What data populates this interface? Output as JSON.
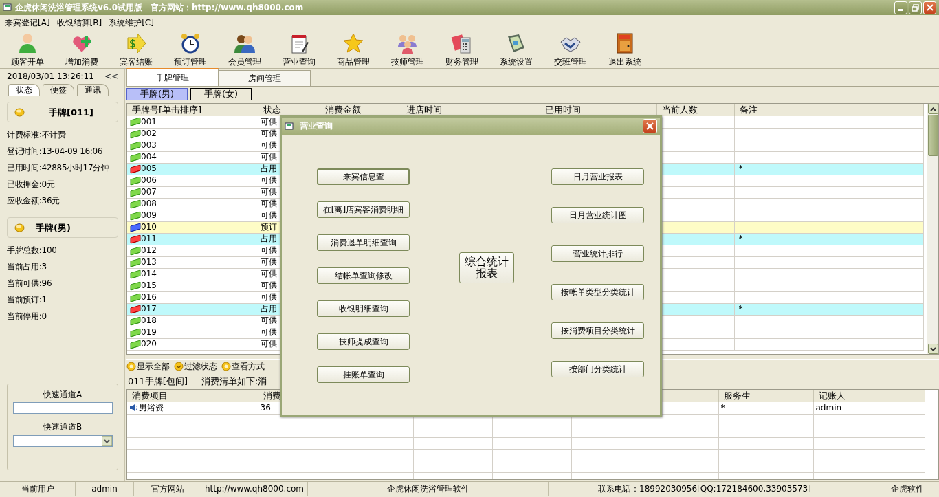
{
  "window": {
    "title": "企虎休闲洗浴管理系统v6.0试用版　官方网站：http://www.qh8000.com"
  },
  "menu": [
    "来宾登记[A]",
    "收银结算[B]",
    "系统维护[C]"
  ],
  "toolbar": [
    "顾客开单",
    "增加消费",
    "宾客结账",
    "预订管理",
    "会员管理",
    "营业查询",
    "商品管理",
    "技师管理",
    "财务管理",
    "系统设置",
    "交班管理",
    "退出系统"
  ],
  "left_panel": {
    "clock": "2018/03/01 13:26:11",
    "collapse": "<<",
    "tabs": [
      {
        "label": "状态",
        "selected": true
      },
      {
        "label": "便签",
        "selected": false
      },
      {
        "label": "通讯",
        "selected": false
      }
    ],
    "current_card": {
      "title": "手牌[011]",
      "lines": [
        "计费标准:不计费",
        "登记时间:13-04-09 16:06",
        "已用时间:42885小时17分钟",
        "已收押金:0元",
        "应收金额:36元"
      ]
    },
    "group": {
      "title": "手牌(男)",
      "lines": [
        "手牌总数:100",
        "当前占用:3",
        "当前可供:96",
        "当前预订:1",
        "当前停用:0"
      ]
    },
    "quick_a": {
      "label": "快速通道A"
    },
    "quick_b": {
      "label": "快速通道B"
    }
  },
  "tabs": [
    {
      "label": "手牌管理",
      "selected": true
    },
    {
      "label": "房间管理",
      "selected": false
    }
  ],
  "subtabs": [
    {
      "label": "手牌(男)",
      "selected": true
    },
    {
      "label": "手牌(女)",
      "selected": false
    }
  ],
  "card_table": {
    "columns": [
      "手牌号[单击排序]",
      "状态",
      "消费金额",
      "进店时间",
      "已用时间",
      "当前人数",
      "备注"
    ],
    "rows": [
      {
        "number": "001",
        "kind": "free",
        "status": "可供"
      },
      {
        "number": "002",
        "kind": "free",
        "status": "可供"
      },
      {
        "number": "003",
        "kind": "free",
        "status": "可供"
      },
      {
        "number": "004",
        "kind": "free",
        "status": "可供"
      },
      {
        "number": "005",
        "kind": "occupied",
        "status": "占用",
        "remark": "*"
      },
      {
        "number": "006",
        "kind": "free",
        "status": "可供"
      },
      {
        "number": "007",
        "kind": "free",
        "status": "可供"
      },
      {
        "number": "008",
        "kind": "free",
        "status": "可供"
      },
      {
        "number": "009",
        "kind": "free",
        "status": "可供"
      },
      {
        "number": "010",
        "kind": "reserved",
        "status": "预订"
      },
      {
        "number": "011",
        "kind": "occupied",
        "status": "占用",
        "remark": "*"
      },
      {
        "number": "012",
        "kind": "free",
        "status": "可供"
      },
      {
        "number": "013",
        "kind": "free",
        "status": "可供"
      },
      {
        "number": "014",
        "kind": "free",
        "status": "可供"
      },
      {
        "number": "015",
        "kind": "free",
        "status": "可供"
      },
      {
        "number": "016",
        "kind": "free",
        "status": "可供"
      },
      {
        "number": "017",
        "kind": "occupied",
        "status": "占用",
        "remark": "*"
      },
      {
        "number": "018",
        "kind": "free",
        "status": "可供"
      },
      {
        "number": "019",
        "kind": "free",
        "status": "可供"
      },
      {
        "number": "020",
        "kind": "free",
        "status": "可供"
      }
    ]
  },
  "filters": [
    "显示全部",
    "过滤状态",
    "查看方式"
  ],
  "selection": {
    "card": "011手牌[包间]",
    "note": "消费清单如下:消"
  },
  "bill_table": {
    "columns_left": [
      "消费项目",
      "消费"
    ],
    "columns_right": [
      "服务生",
      "记账人"
    ],
    "rows": [
      {
        "item": "男浴资",
        "amount": "36",
        "waiter": "*",
        "clerk": "admin"
      }
    ]
  },
  "dialog": {
    "title": "营业查询",
    "left_buttons": [
      "来宾信息查",
      "在[离]店宾客消费明细",
      "消费退单明细查询",
      "结帐单查询修改",
      "收银明细查询",
      "技师提成查询",
      "挂账单查询"
    ],
    "center_button": "综合统计报表",
    "right_buttons": [
      "日月营业报表",
      "日月营业统计图",
      "营业统计排行",
      "按帐单类型分类统计",
      "按消费项目分类统计",
      "按部门分类统计"
    ]
  },
  "status_bar": [
    "当前用户",
    "admin",
    "官方网站",
    "http://www.qh8000.com",
    "企虎休闲洗浴管理软件",
    "联系电话：18992030956[QQ:172184600,33903573]",
    "企虎软件"
  ]
}
